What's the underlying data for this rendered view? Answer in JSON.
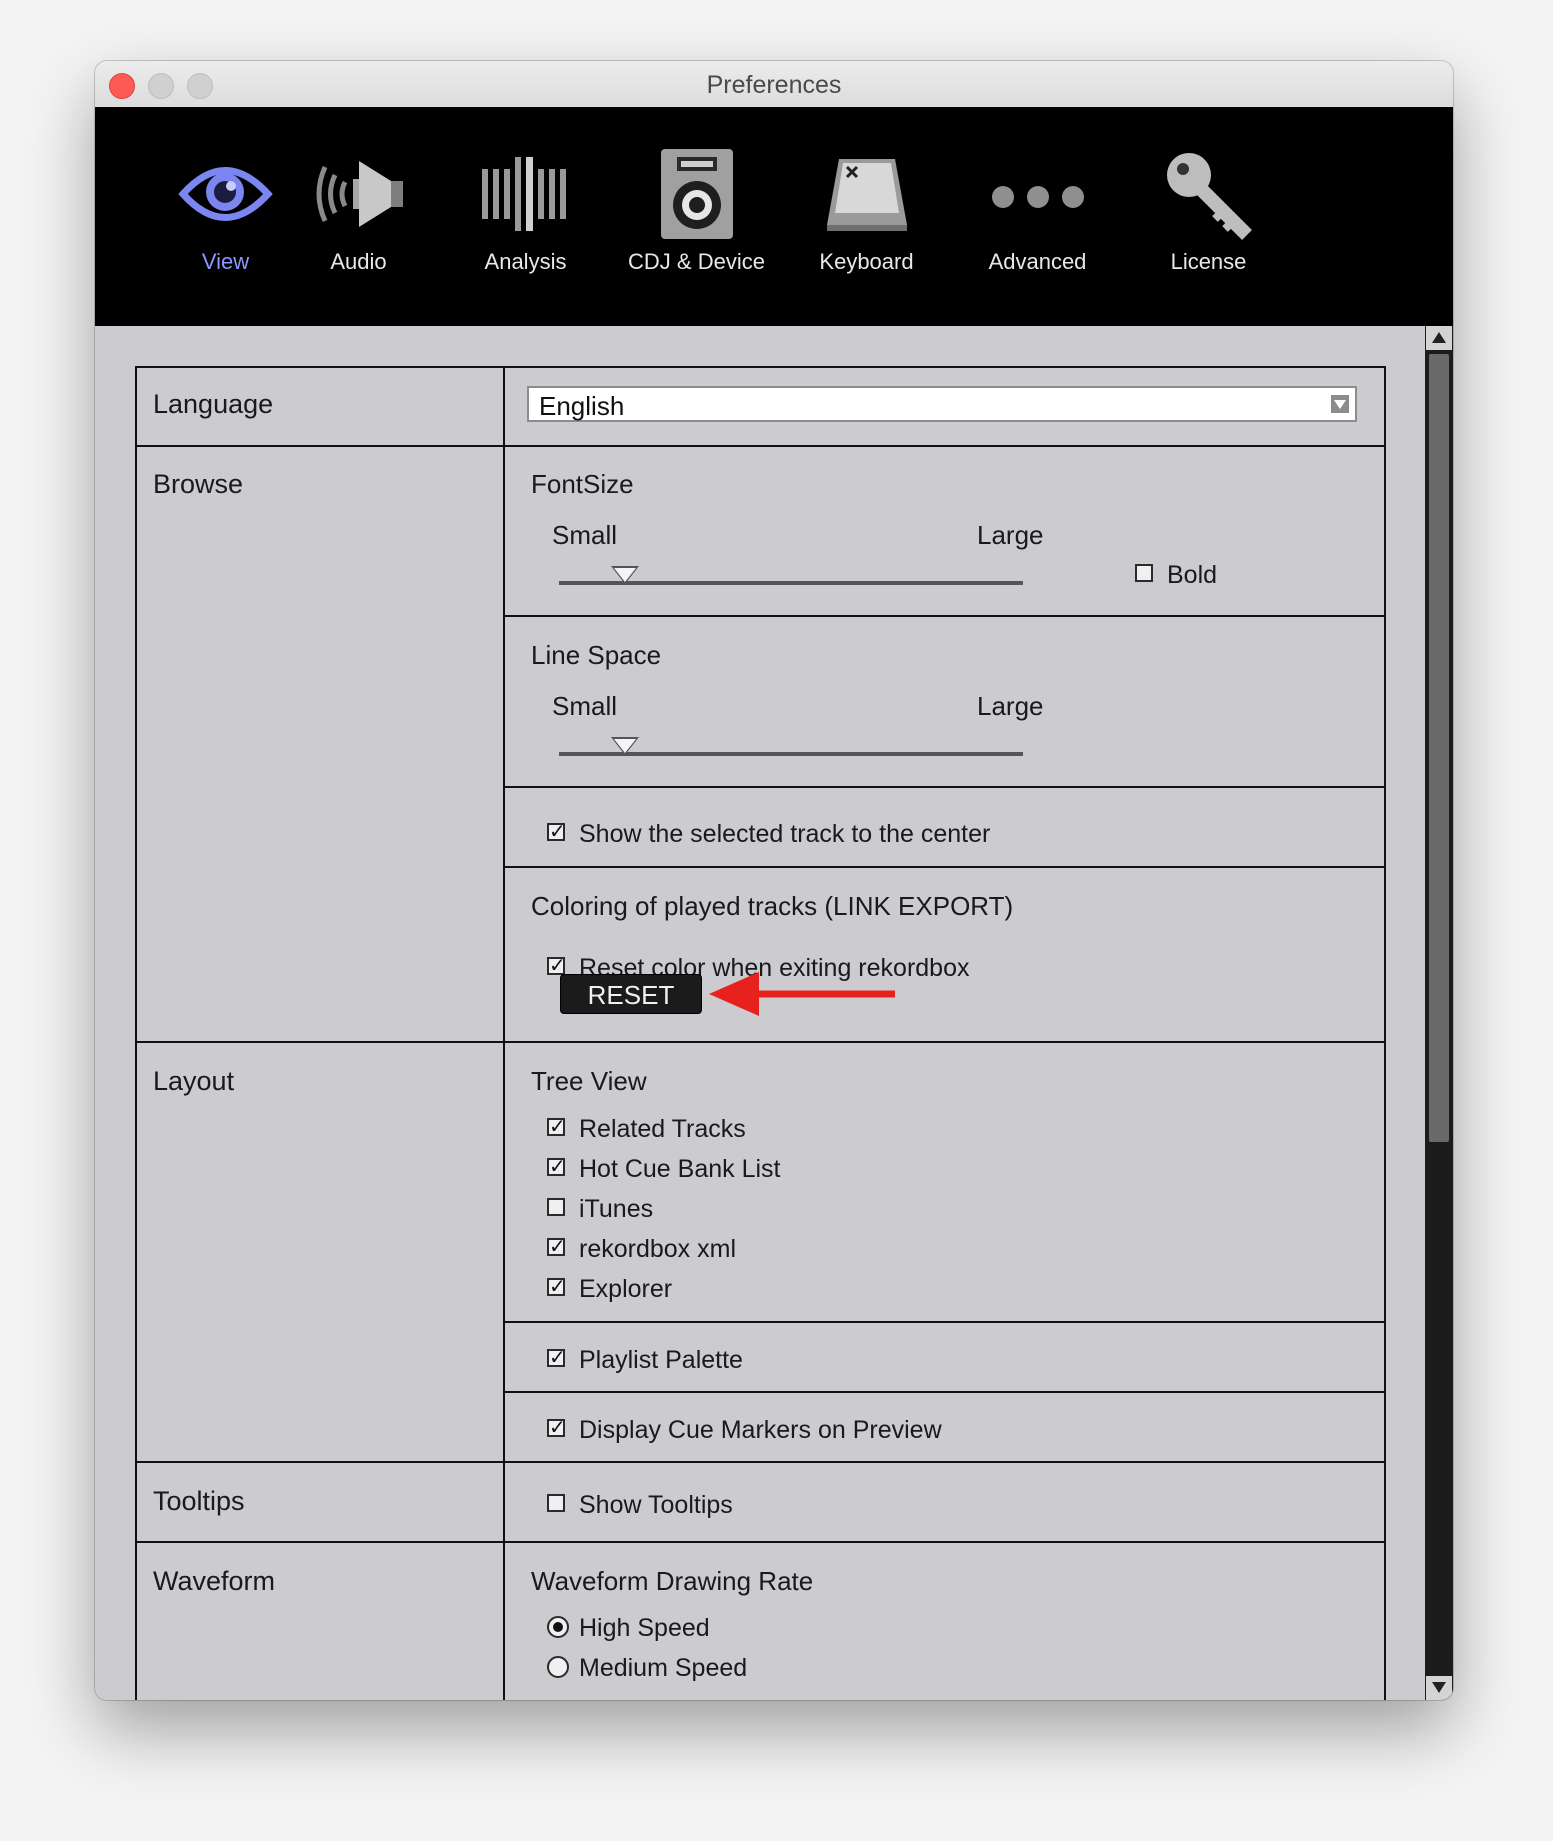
{
  "window": {
    "title": "Preferences"
  },
  "toolbar": {
    "items": [
      {
        "label": "View",
        "icon": "eye-icon",
        "active": true
      },
      {
        "label": "Audio",
        "icon": "speaker-icon"
      },
      {
        "label": "Analysis",
        "icon": "waveform-bars-icon"
      },
      {
        "label": "CDJ & Device",
        "icon": "cdj-device-icon"
      },
      {
        "label": "Keyboard",
        "icon": "keyboard-key-icon"
      },
      {
        "label": "Advanced",
        "icon": "dots-icon"
      },
      {
        "label": "License",
        "icon": "key-icon"
      }
    ],
    "active_color": "#8a97ff"
  },
  "sections": {
    "language": {
      "label": "Language",
      "value": "English"
    },
    "browse": {
      "label": "Browse",
      "fontsize": {
        "title": "FontSize",
        "small": "Small",
        "large": "Large",
        "level": 0.14,
        "bold_label": "Bold",
        "bold_checked": false
      },
      "linespace": {
        "title": "Line Space",
        "small": "Small",
        "large": "Large",
        "level": 0.14
      },
      "center": {
        "label": "Show the selected track to the center",
        "checked": true
      },
      "coloring": {
        "title": "Coloring of played tracks  (LINK EXPORT)",
        "reset_label": "Reset color when exiting rekordbox",
        "reset_checked": true,
        "button": "RESET"
      }
    },
    "layout": {
      "label": "Layout",
      "treeview": {
        "title": "Tree View",
        "items": [
          {
            "label": "Related Tracks",
            "checked": true
          },
          {
            "label": "Hot Cue Bank List",
            "checked": true
          },
          {
            "label": "iTunes",
            "checked": false
          },
          {
            "label": "rekordbox xml",
            "checked": true
          },
          {
            "label": "Explorer",
            "checked": true
          }
        ]
      },
      "playlist_palette": {
        "label": "Playlist Palette",
        "checked": true
      },
      "cue_markers": {
        "label": "Display Cue Markers on Preview",
        "checked": true
      }
    },
    "tooltips": {
      "label": "Tooltips",
      "option": "Show Tooltips",
      "checked": false
    },
    "waveform": {
      "label": "Waveform",
      "title": "Waveform Drawing Rate",
      "options": [
        {
          "label": "High Speed",
          "selected": true
        },
        {
          "label": "Medium Speed",
          "selected": false
        }
      ]
    }
  },
  "annotation": {
    "color": "#e8211d"
  }
}
